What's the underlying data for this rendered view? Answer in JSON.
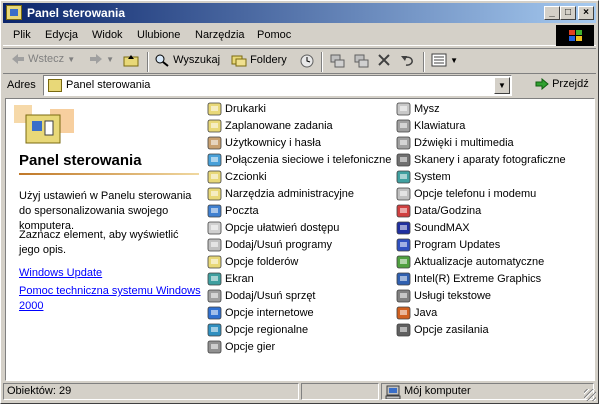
{
  "window": {
    "title": "Panel sterowania",
    "buttons": {
      "minimize": "_",
      "maximize": "□",
      "close": "×"
    }
  },
  "menubar": {
    "items": [
      "Plik",
      "Edycja",
      "Widok",
      "Ulubione",
      "Narzędzia",
      "Pomoc"
    ]
  },
  "toolbar": {
    "back_label": "Wstecz",
    "search_label": "Wyszukaj",
    "folders_label": "Foldery"
  },
  "address": {
    "label": "Adres",
    "value": "Panel sterowania",
    "go_label": "Przejdź"
  },
  "leftpane": {
    "title": "Panel sterowania",
    "desc": "Użyj ustawień w Panelu sterowania do spersonalizowania swojego komputera.",
    "hint": "Zaznacz element, aby wyświetlić jego opis.",
    "links": [
      "Windows Update",
      "Pomoc techniczna systemu Windows 2000"
    ]
  },
  "items_col1": [
    {
      "label": "Drukarki",
      "icon": "printer-icon",
      "color": "#e8d878"
    },
    {
      "label": "Zaplanowane zadania",
      "icon": "scheduled-tasks-icon",
      "color": "#e8d878"
    },
    {
      "label": "Użytkownicy i hasła",
      "icon": "users-icon",
      "color": "#c8a070"
    },
    {
      "label": "Połączenia sieciowe i telefoniczne",
      "icon": "network-icon",
      "color": "#48a0d8"
    },
    {
      "label": "Czcionki",
      "icon": "fonts-icon",
      "color": "#e8d878"
    },
    {
      "label": "Narzędzia administracyjne",
      "icon": "admin-tools-icon",
      "color": "#e8d878"
    },
    {
      "label": "Poczta",
      "icon": "mail-icon",
      "color": "#4080d0"
    },
    {
      "label": "Opcje ułatwień dostępu",
      "icon": "accessibility-icon",
      "color": "#d0d0d0"
    },
    {
      "label": "Dodaj/Usuń programy",
      "icon": "add-remove-programs-icon",
      "color": "#c0c0c0"
    },
    {
      "label": "Opcje folderów",
      "icon": "folder-options-icon",
      "color": "#e8d878"
    },
    {
      "label": "Ekran",
      "icon": "display-icon",
      "color": "#40a0a0"
    },
    {
      "label": "Dodaj/Usuń sprzęt",
      "icon": "add-hardware-icon",
      "color": "#a0a0a0"
    },
    {
      "label": "Opcje internetowe",
      "icon": "internet-options-icon",
      "color": "#3070d0"
    },
    {
      "label": "Opcje regionalne",
      "icon": "regional-options-icon",
      "color": "#3090c0"
    },
    {
      "label": "Opcje gier",
      "icon": "game-controllers-icon",
      "color": "#909090"
    }
  ],
  "items_col2": [
    {
      "label": "Mysz",
      "icon": "mouse-icon",
      "color": "#c8c8c8"
    },
    {
      "label": "Klawiatura",
      "icon": "keyboard-icon",
      "color": "#a0a0a0"
    },
    {
      "label": "Dźwięki i multimedia",
      "icon": "sounds-icon",
      "color": "#a0a0a0"
    },
    {
      "label": "Skanery i aparaty fotograficzne",
      "icon": "scanners-icon",
      "color": "#707070"
    },
    {
      "label": "System",
      "icon": "system-icon",
      "color": "#40a0a0"
    },
    {
      "label": "Opcje telefonu i modemu",
      "icon": "phone-modem-icon",
      "color": "#c0c0c0"
    },
    {
      "label": "Data/Godzina",
      "icon": "date-time-icon",
      "color": "#d04040"
    },
    {
      "label": "SoundMAX",
      "icon": "soundmax-icon",
      "color": "#2030a0"
    },
    {
      "label": "Program Updates",
      "icon": "program-updates-icon",
      "color": "#3050c0"
    },
    {
      "label": "Aktualizacje automatyczne",
      "icon": "automatic-updates-icon",
      "color": "#50a040"
    },
    {
      "label": "Intel(R) Extreme Graphics",
      "icon": "intel-graphics-icon",
      "color": "#3060b0"
    },
    {
      "label": "Usługi tekstowe",
      "icon": "text-services-icon",
      "color": "#808080"
    },
    {
      "label": "Java",
      "icon": "java-icon",
      "color": "#d06020"
    },
    {
      "label": "Opcje zasilania",
      "icon": "power-options-icon",
      "color": "#606060"
    }
  ],
  "statusbar": {
    "objects": "Obiektów: 29",
    "location": "Mój komputer"
  }
}
